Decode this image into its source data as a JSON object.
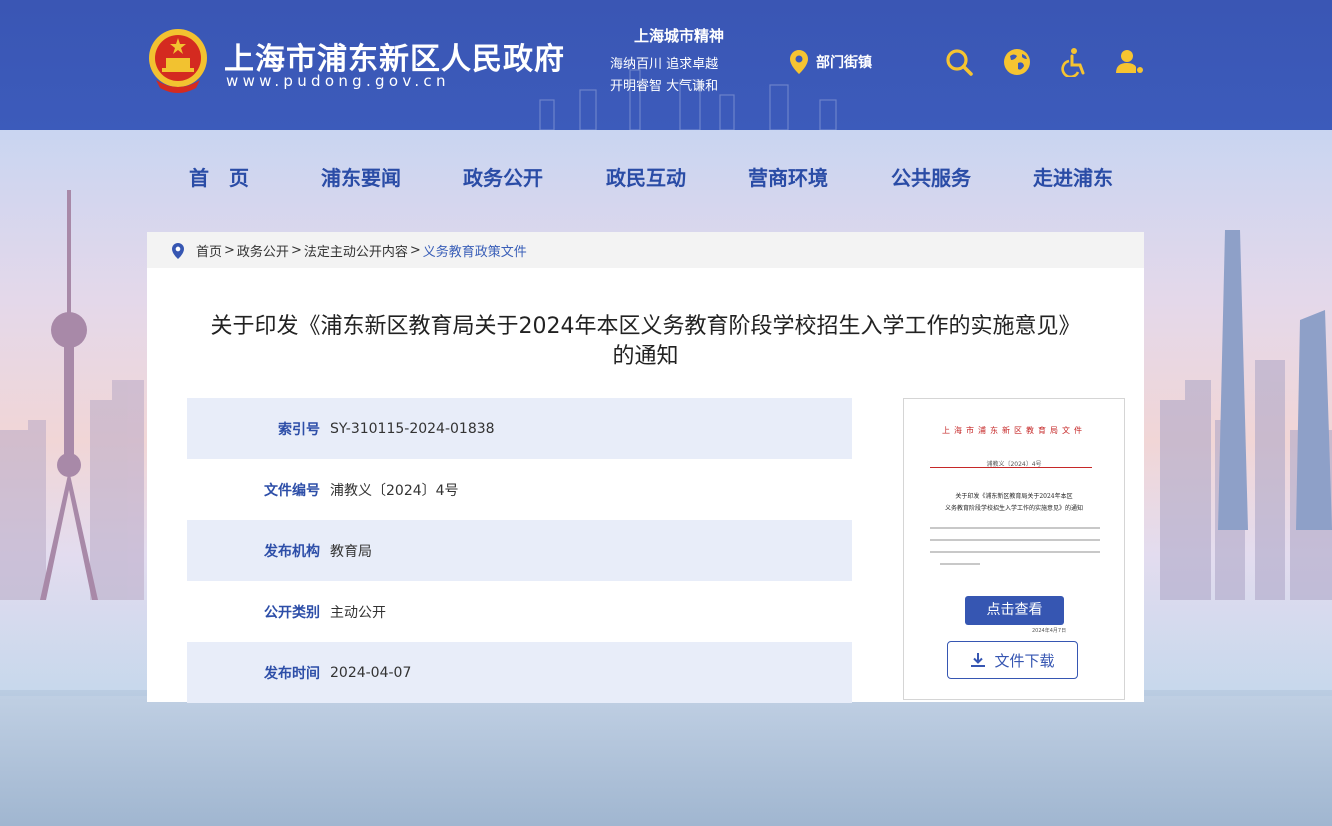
{
  "header": {
    "site_title": "上海市浦东新区人民政府",
    "site_url": "www.pudong.gov.cn",
    "spirit_title": "上海城市精神",
    "spirit_line1": "海纳百川  追求卓越",
    "spirit_line2": "开明睿智  大气谦和",
    "dept_label": "部门街镇",
    "icons": [
      "location-pin-icon",
      "search-icon",
      "globe-icon",
      "accessibility-icon",
      "user-icon"
    ],
    "accent": "#f6c431",
    "bg": "#3b58b8"
  },
  "nav": {
    "items": [
      "首　页",
      "浦东要闻",
      "政务公开",
      "政民互动",
      "营商环境",
      "公共服务",
      "走进浦东"
    ]
  },
  "breadcrumb": {
    "home": "首页",
    "sep": ">",
    "level1": "政务公开",
    "level2": "法定主动公开内容",
    "current": "义务教育政策文件"
  },
  "article": {
    "title_line1": "关于印发《浦东新区教育局关于2024年本区义务教育阶段学校招生入学工作的实施意见》",
    "title_line2": "的通知"
  },
  "meta": [
    {
      "label": "索引号",
      "value": "SY-310115-2024-01838"
    },
    {
      "label": "文件编号",
      "value": "浦教义〔2024〕4号"
    },
    {
      "label": "发布机构",
      "value": "教育局"
    },
    {
      "label": "公开类别",
      "value": "主动公开"
    },
    {
      "label": "发布时间",
      "value": "2024-04-07"
    }
  ],
  "doc_preview": {
    "header": "上海市浦东新区教育局文件",
    "doc_number": "浦教义〔2024〕4号",
    "title_line1": "关于印发《浦东新区教育局关于2024年本区",
    "title_line2": "义务教育阶段学校招生入学工作的实施意见》的通知",
    "view_button": "点击查看",
    "date": "2024年4月7日",
    "download_button": "文件下载"
  },
  "colors": {
    "nav_text": "#2a4ca6",
    "meta_label": "#2d4ea8",
    "doc_red": "#c62828",
    "button_blue": "#3656b2"
  }
}
